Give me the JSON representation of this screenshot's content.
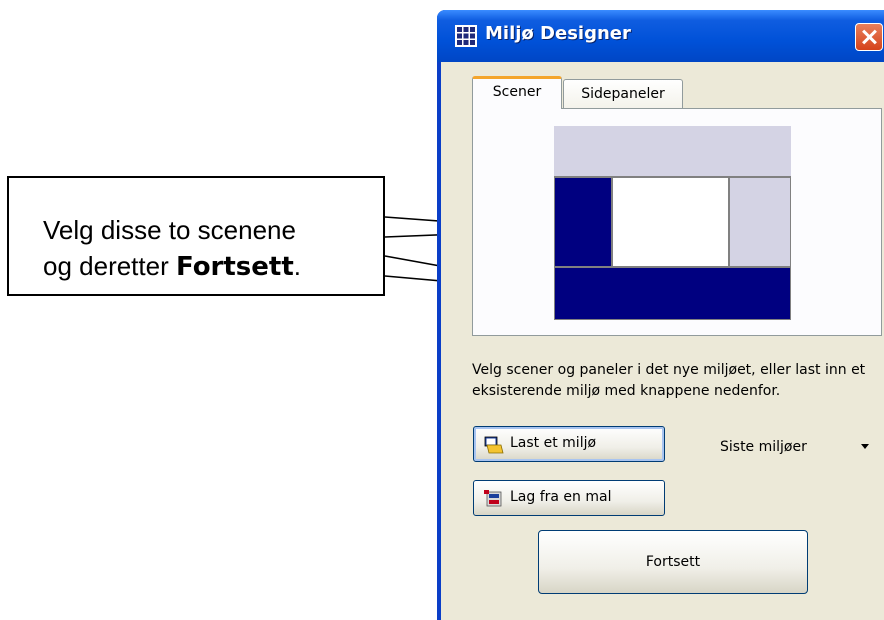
{
  "callout": {
    "line1": "Velg disse to scenene",
    "line2_prefix": "og deretter ",
    "line2_bold": "Fortsett",
    "line2_suffix": "."
  },
  "window": {
    "title": "Miljø Designer",
    "title_icon": "grid-icon",
    "close_icon": "close-icon"
  },
  "tabs": [
    {
      "label": "Scener",
      "active": true
    },
    {
      "label": "Sidepaneler",
      "active": false
    }
  ],
  "layout_preview": {
    "cells": [
      {
        "name": "top-scene",
        "state": "unselected"
      },
      {
        "name": "left-scene",
        "state": "selected"
      },
      {
        "name": "center-scene",
        "state": "main"
      },
      {
        "name": "right-scene",
        "state": "unselected"
      },
      {
        "name": "bottom-scene",
        "state": "selected"
      }
    ],
    "colors": {
      "selected": "#000080",
      "unselected": "#d4d3e4",
      "main": "#ffffff"
    }
  },
  "instruction": "Velg scener og paneler i det nye miljøet, eller last inn et eksisterende miljø med knappene nedenfor.",
  "buttons": {
    "load": {
      "label": "Last et miljø",
      "icon": "open-folder-icon"
    },
    "template": {
      "label": "Lag fra en mal",
      "icon": "template-icon"
    },
    "continue": {
      "label": "Fortsett"
    }
  },
  "recent": {
    "label": "Siste miljøer",
    "icon": "dropdown-arrow-icon"
  }
}
